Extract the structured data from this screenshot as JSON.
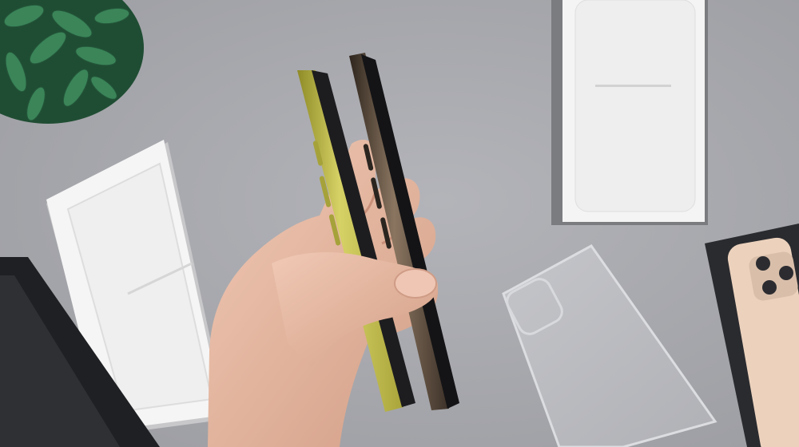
{
  "scene": {
    "subject": "hand-holding-two-phones",
    "objects": [
      "plant",
      "white-phone-box",
      "open-phone-box",
      "clear-phone-case",
      "dark-phone-box",
      "gold-phone-back",
      "yellow-phone",
      "gold-phone",
      "hand"
    ]
  },
  "colors": {
    "surface": "#a8a9ae",
    "box_white": "#f3f3f3",
    "box_shadow": "#c9c9cb",
    "dark_box": "#2b2c30",
    "yellow_phone": "#c6c24e",
    "gold_phone": "#5a4a3c",
    "gold_back": "#ecd2bd",
    "skin": "#e4b8a2",
    "plant": "#2f6f4a"
  }
}
